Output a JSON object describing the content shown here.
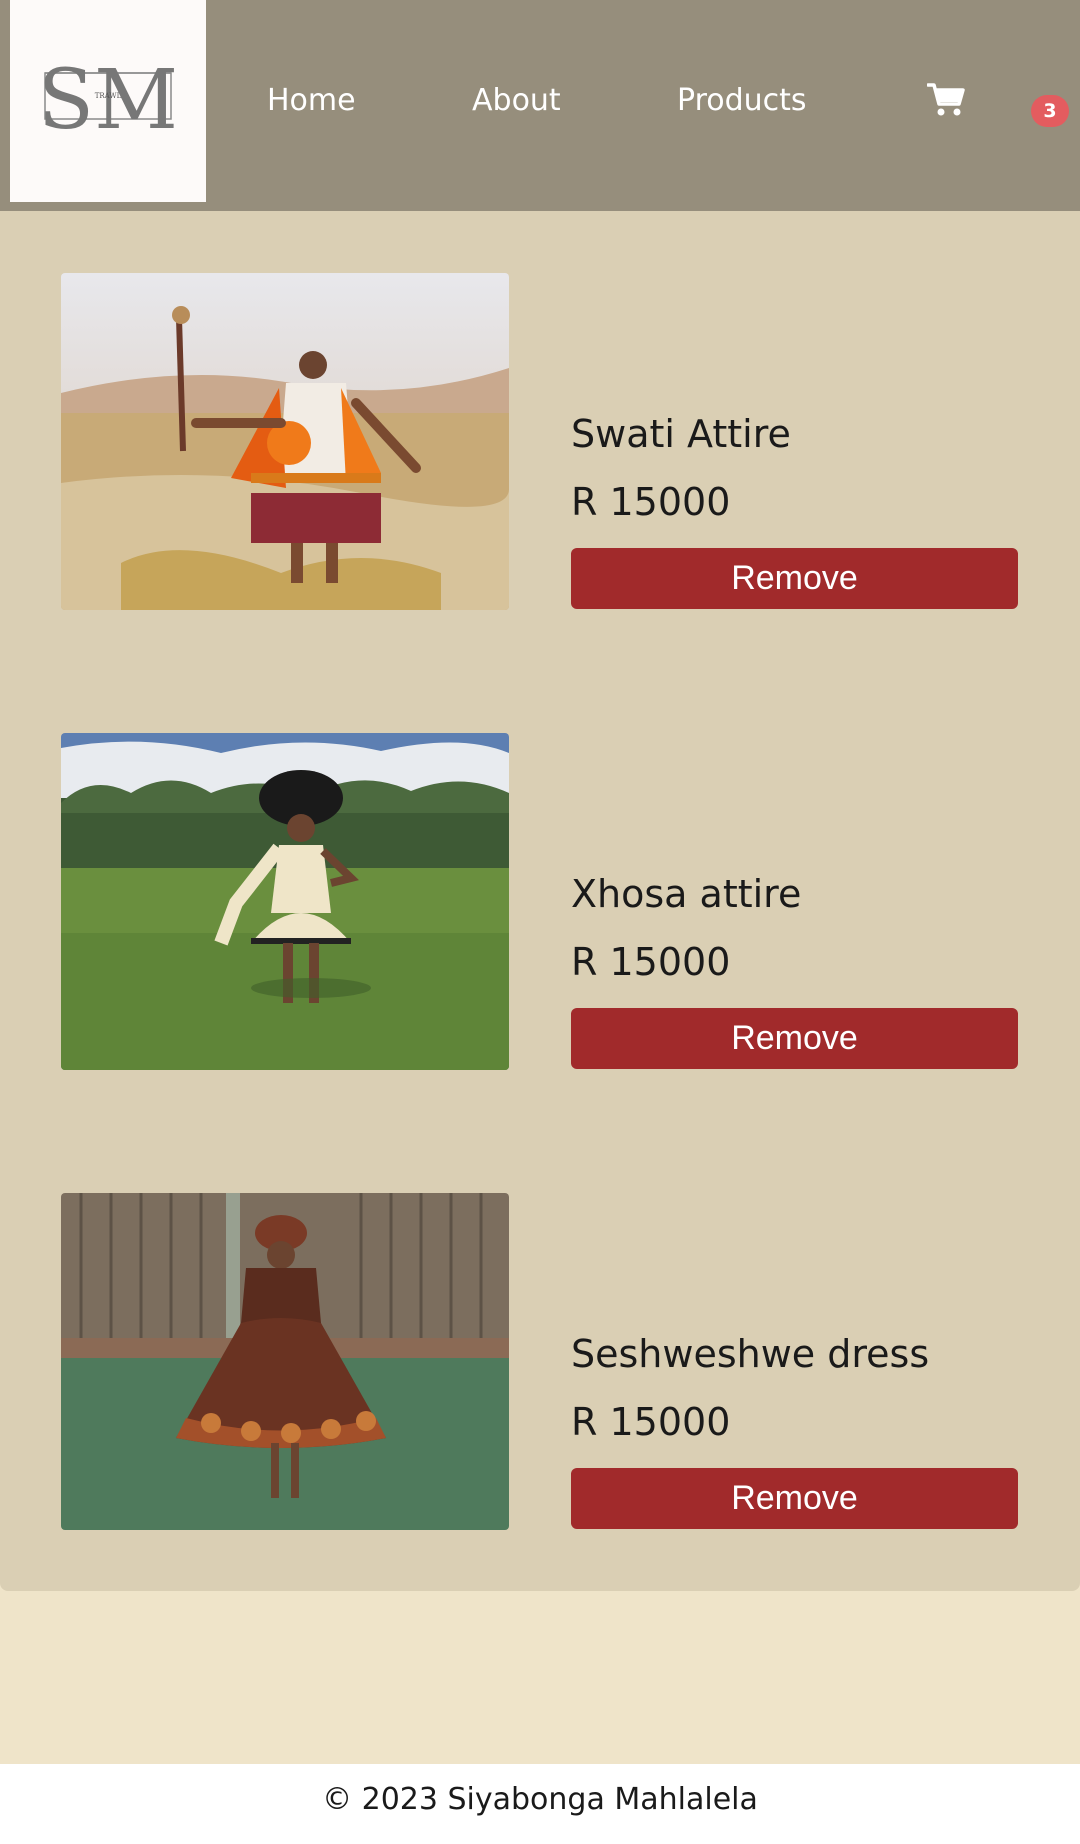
{
  "brand": {
    "logo_text": "SM",
    "logo_subtext": "TRAWL"
  },
  "nav": {
    "items": [
      {
        "label": "Home"
      },
      {
        "label": "About"
      },
      {
        "label": "Products"
      }
    ],
    "cart_icon": "shopping-cart-icon",
    "cart_count": "3"
  },
  "cart": {
    "items": [
      {
        "name": "Swati Attire",
        "price": "R 15000",
        "remove_label": "Remove"
      },
      {
        "name": "Xhosa attire",
        "price": "R 15000",
        "remove_label": "Remove"
      },
      {
        "name": "Seshweshwe dress",
        "price": "R 15000",
        "remove_label": "Remove"
      }
    ]
  },
  "footer": {
    "text": "© 2023 Siyabonga Mahlalela"
  },
  "colors": {
    "navbar": "#968e7c",
    "panel": "#dacfb4",
    "page_bg": "#efe4c9",
    "remove_button": "#a12a2b",
    "badge": "#e35c5f"
  }
}
